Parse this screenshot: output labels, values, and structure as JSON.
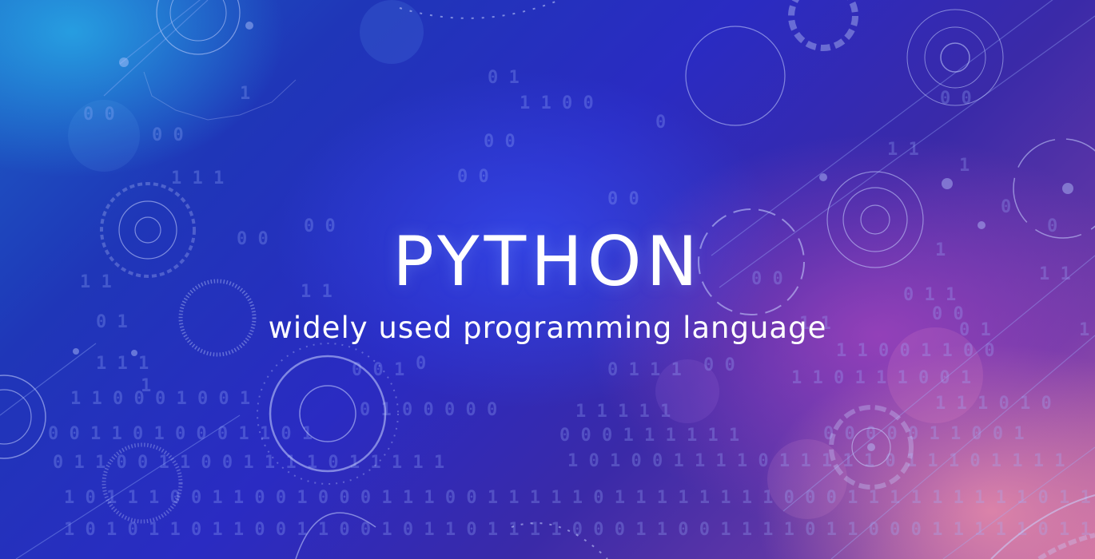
{
  "banner": {
    "title": "PYTHON",
    "subtitle": "widely used programming language"
  },
  "theme": {
    "text_color": "#ffffff",
    "background_colors": [
      "#1c5fc4",
      "#2a2bc2",
      "#6b3aa6",
      "#c56aa0"
    ],
    "decoration": [
      "binary-digits",
      "gear-rings",
      "circuit-lines"
    ]
  }
}
